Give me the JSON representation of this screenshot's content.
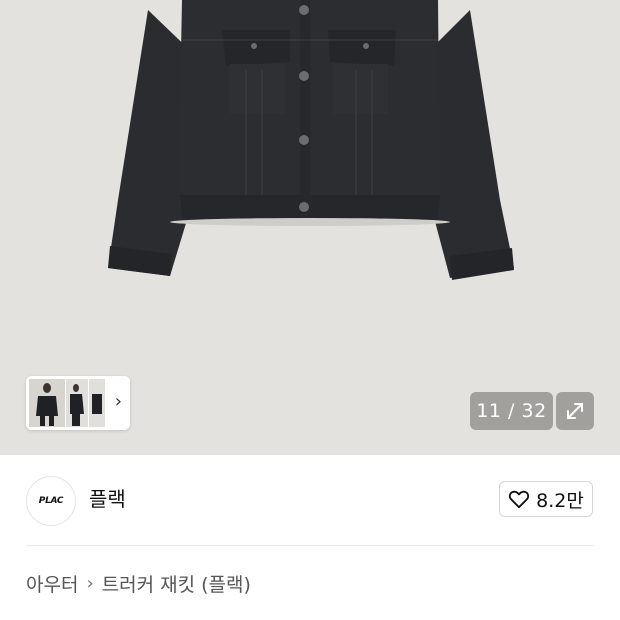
{
  "gallery": {
    "counter": "11 / 32",
    "thumbnail_arrow": "›",
    "icons": {
      "expand": "expand-arrows-icon",
      "next": "chevron-right-icon"
    }
  },
  "brand": {
    "logo_text": "PLAC",
    "name": "플랙",
    "like_count": "8.2만",
    "like_icon": "heart-outline-icon"
  },
  "breadcrumb": {
    "items": [
      "아우터",
      "트러커 재킷 (플랙)"
    ],
    "separator": "›"
  },
  "colors": {
    "hero_background": "#e4e2df",
    "jacket": "#26282b",
    "overlay_badge": "#8c8a87"
  }
}
